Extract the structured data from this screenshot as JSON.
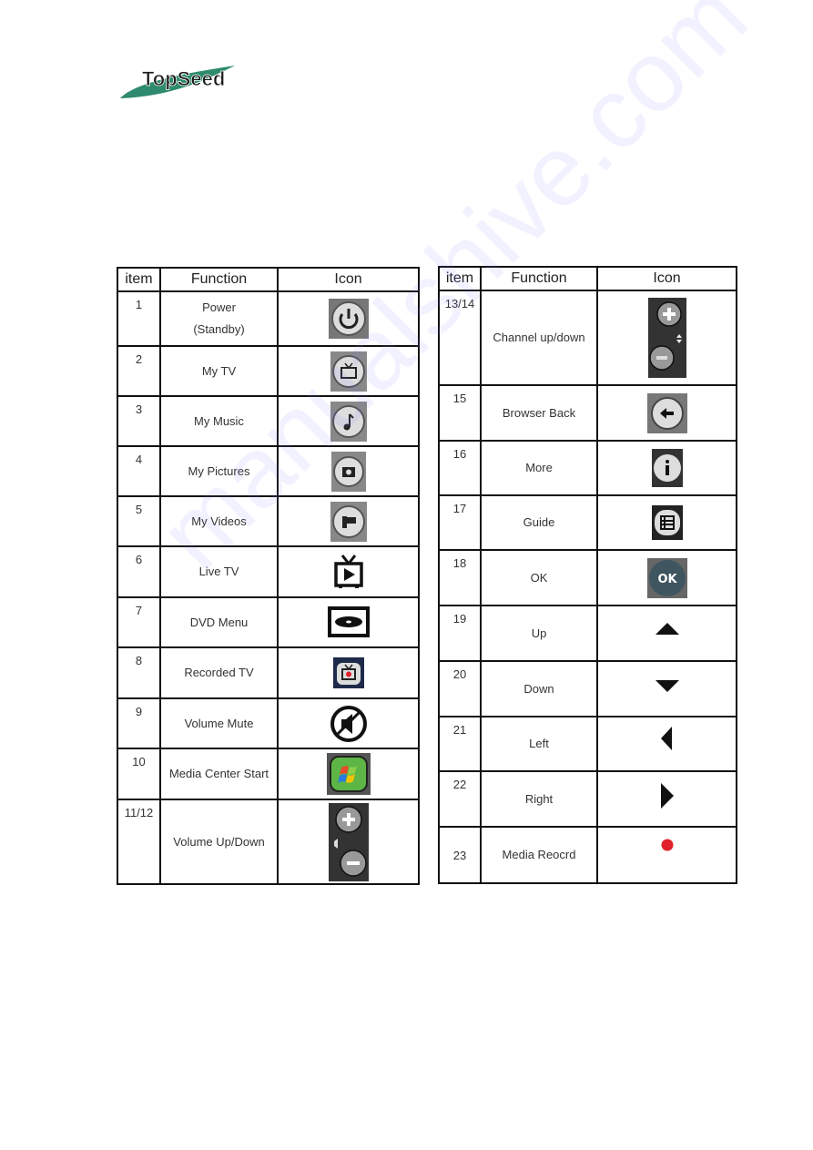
{
  "logo": {
    "text": "TopSeed",
    "colors": {
      "swoosh": "#2e8b6e",
      "text": "#1a1a1a"
    }
  },
  "watermark": "manualshive.com",
  "headers": {
    "item": "item",
    "function": "Function",
    "icon": "Icon"
  },
  "left_table": [
    {
      "item": "1",
      "function": "Power",
      "function2": "(Standby)",
      "icon": "power-icon"
    },
    {
      "item": "2",
      "function": "My TV",
      "icon": "my-tv-icon"
    },
    {
      "item": "3",
      "function": "My Music",
      "icon": "music-note-icon"
    },
    {
      "item": "4",
      "function": "My Pictures",
      "icon": "camera-icon"
    },
    {
      "item": "5",
      "function": "My Videos",
      "icon": "video-camera-icon"
    },
    {
      "item": "6",
      "function": "Live TV",
      "icon": "live-tv-icon"
    },
    {
      "item": "7",
      "function": "DVD Menu",
      "icon": "dvd-menu-icon"
    },
    {
      "item": "8",
      "function": "Recorded TV",
      "icon": "recorded-tv-icon"
    },
    {
      "item": "9",
      "function": "Volume Mute",
      "icon": "mute-icon"
    },
    {
      "item": "10",
      "function": "Media Center Start",
      "icon": "windows-start-icon"
    },
    {
      "item": "11/12",
      "function": "Volume Up/Down",
      "icon": "volume-up-down-icon"
    }
  ],
  "right_table": [
    {
      "item": "13/14",
      "function": "Channel up/down",
      "icon": "channel-up-down-icon"
    },
    {
      "item": "15",
      "function": "Browser Back",
      "icon": "back-arrow-icon"
    },
    {
      "item": "16",
      "function": "More",
      "icon": "info-icon"
    },
    {
      "item": "17",
      "function": "Guide",
      "icon": "guide-icon"
    },
    {
      "item": "18",
      "function": "OK",
      "icon": "ok-icon",
      "icon_text": "OK"
    },
    {
      "item": "19",
      "function": "Up",
      "icon": "up-triangle-icon"
    },
    {
      "item": "20",
      "function": "Down",
      "icon": "down-triangle-icon"
    },
    {
      "item": "21",
      "function": "Left",
      "icon": "left-triangle-icon"
    },
    {
      "item": "22",
      "function": "Right",
      "icon": "right-triangle-icon"
    },
    {
      "item": "23",
      "function": "Media Reocrd",
      "icon": "record-dot-icon"
    }
  ],
  "colors": {
    "record_red": "#e0202a",
    "media_center_green": "#5cb544",
    "ok_button": "#3f5560"
  }
}
